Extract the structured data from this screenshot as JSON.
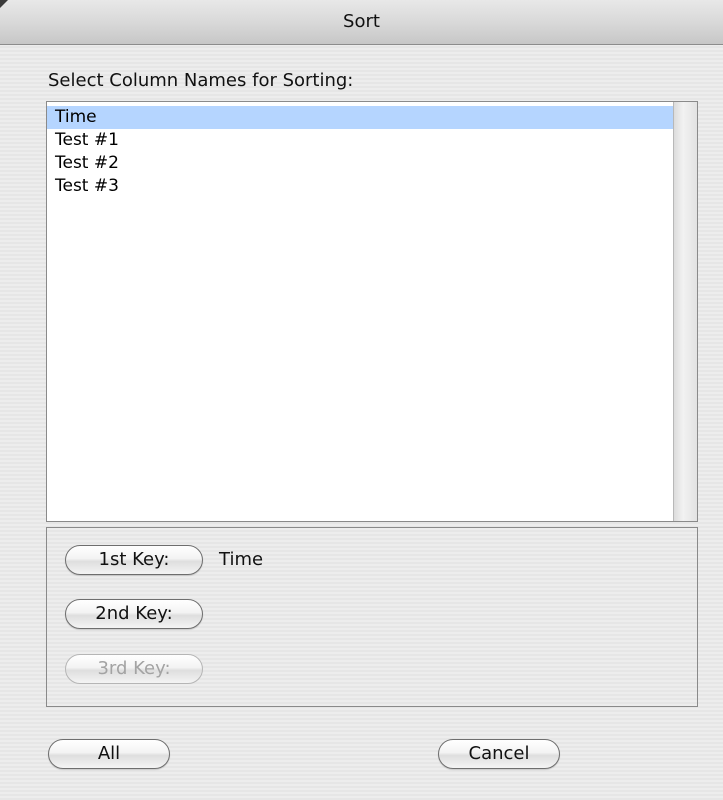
{
  "window": {
    "title": "Sort"
  },
  "prompt": "Select Column Names for Sorting:",
  "columns": [
    {
      "label": "Time",
      "selected": true
    },
    {
      "label": "Test #1",
      "selected": false
    },
    {
      "label": "Test #2",
      "selected": false
    },
    {
      "label": "Test #3",
      "selected": false
    }
  ],
  "keys": {
    "first": {
      "label": "1st Key:",
      "value": "Time",
      "enabled": true
    },
    "second": {
      "label": "2nd Key:",
      "value": "",
      "enabled": true
    },
    "third": {
      "label": "3rd Key:",
      "value": "",
      "enabled": false
    }
  },
  "buttons": {
    "all": "All",
    "cancel": "Cancel"
  },
  "colors": {
    "selection": "#b5d5ff",
    "disabled_text": "#a3a3a3"
  }
}
